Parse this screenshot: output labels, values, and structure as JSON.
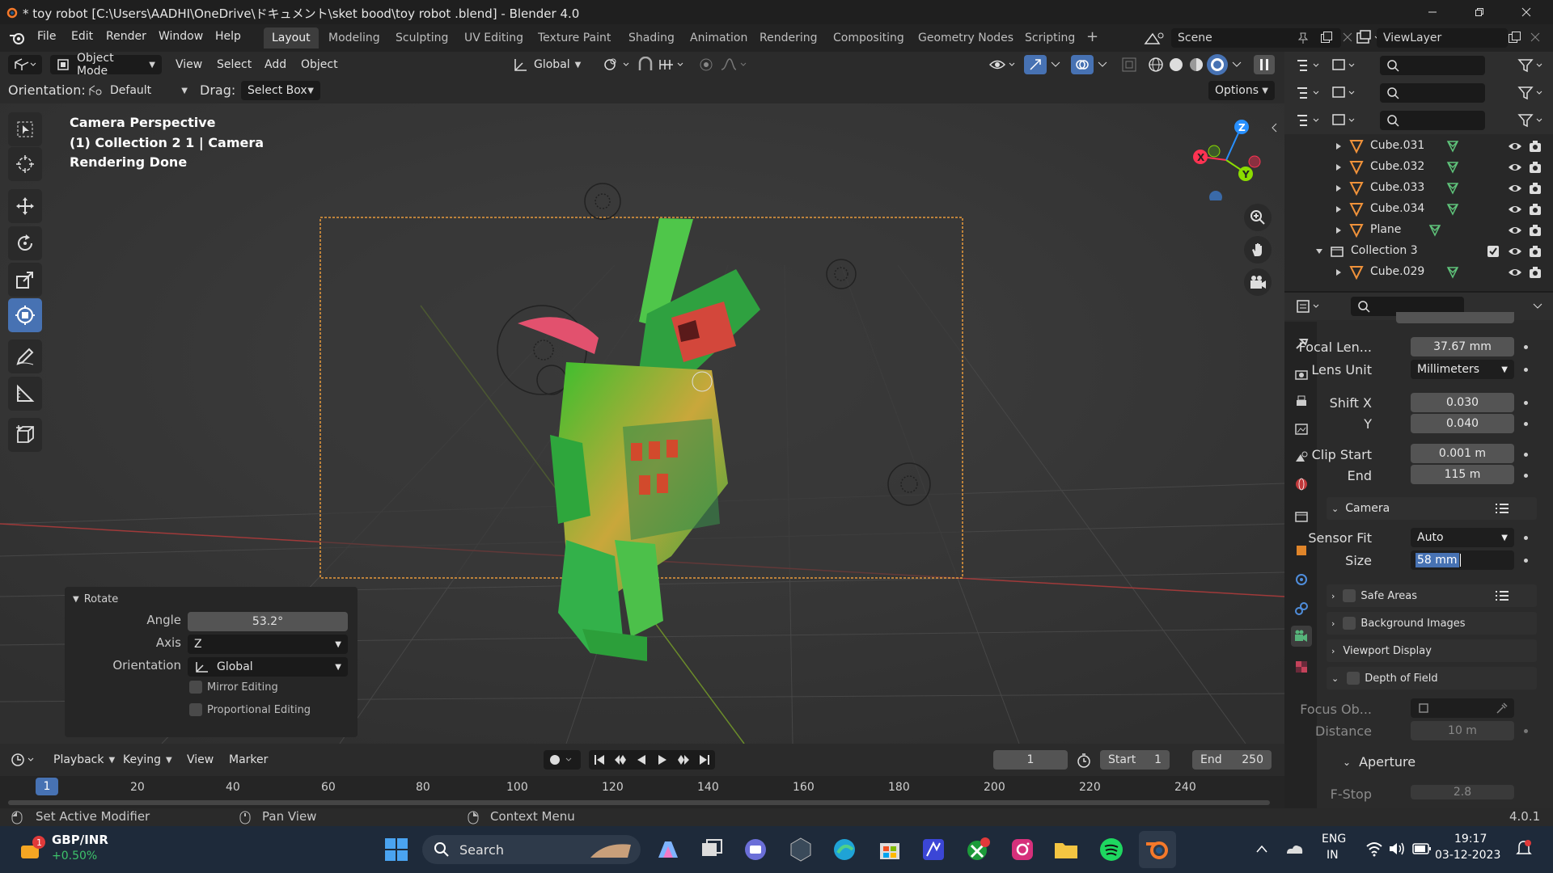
{
  "window": {
    "title": "* toy robot  [C:\\Users\\AADHI\\OneDrive\\ドキュメント\\sket bood\\toy robot .blend] - Blender 4.0"
  },
  "menu": [
    "File",
    "Edit",
    "Render",
    "Window",
    "Help"
  ],
  "workspaces": [
    "Layout",
    "Modeling",
    "Sculpting",
    "UV Editing",
    "Texture Paint",
    "Shading",
    "Animation",
    "Rendering",
    "Compositing",
    "Geometry Nodes",
    "Scripting"
  ],
  "scene": {
    "label": "Scene",
    "view_layer": "ViewLayer"
  },
  "viewport_header": {
    "mode": "Object Mode",
    "menus": [
      "View",
      "Select",
      "Add",
      "Object"
    ],
    "transform_orientation": "Global",
    "orientation_label": "Orientation:",
    "orientation_value": "Default",
    "drag_label": "Drag:",
    "drag_value": "Select Box",
    "options": "Options"
  },
  "viewport_overlay": {
    "line1": "Camera Perspective",
    "line2": "(1) Collection 2 1 | Camera",
    "line3": "Rendering Done"
  },
  "gizmo": {
    "x": "X",
    "y": "Y",
    "z": "Z"
  },
  "operator_panel": {
    "title": "Rotate",
    "angle_label": "Angle",
    "angle_value": "53.2°",
    "axis_label": "Axis",
    "axis_value": "Z",
    "orientation_label": "Orientation",
    "orientation_value": "Global",
    "mirror": "Mirror Editing",
    "proportional": "Proportional Editing"
  },
  "timeline": {
    "menus": [
      "Playback",
      "Keying",
      "View",
      "Marker"
    ],
    "current_frame": "1",
    "start_label": "Start",
    "start_value": "1",
    "end_label": "End",
    "end_value": "250",
    "ticks": [
      "1",
      "20",
      "40",
      "60",
      "80",
      "100",
      "120",
      "140",
      "160",
      "180",
      "200",
      "220",
      "240"
    ]
  },
  "status": {
    "left": "Set Active Modifier",
    "middle": "Pan View",
    "right": "Context Menu",
    "version": "4.0.1"
  },
  "outliner": {
    "rows": [
      {
        "name": "Cube.031",
        "indent": 1,
        "type": "mesh"
      },
      {
        "name": "Cube.032",
        "indent": 1,
        "type": "mesh"
      },
      {
        "name": "Cube.033",
        "indent": 1,
        "type": "mesh"
      },
      {
        "name": "Cube.034",
        "indent": 1,
        "type": "mesh"
      },
      {
        "name": "Plane",
        "indent": 1,
        "type": "mesh"
      },
      {
        "name": "Collection 3",
        "indent": 0,
        "type": "collection"
      },
      {
        "name": "Cube.029",
        "indent": 1,
        "type": "mesh"
      }
    ]
  },
  "properties": {
    "focal_label": "Focal Len...",
    "focal_value": "37.67 mm",
    "lens_unit_label": "Lens Unit",
    "lens_unit_value": "Millimeters",
    "shift_x_label": "Shift X",
    "shift_x_value": "0.030",
    "shift_y_label": "Y",
    "shift_y_value": "0.040",
    "clip_start_label": "Clip Start",
    "clip_start_value": "0.001 m",
    "clip_end_label": "End",
    "clip_end_value": "115 m",
    "camera_section": "Camera",
    "sensor_fit_label": "Sensor Fit",
    "sensor_fit_value": "Auto",
    "size_label": "Size",
    "size_value": "58 mm",
    "safe_areas": "Safe Areas",
    "background_images": "Background Images",
    "viewport_display": "Viewport Display",
    "dof": "Depth of Field",
    "focus_label": "Focus Ob...",
    "distance_label": "Distance",
    "distance_value": "10 m",
    "aperture": "Aperture",
    "fstop_label": "F-Stop",
    "fstop_value": "2.8"
  },
  "taskbar": {
    "ticker_name": "GBP/INR",
    "ticker_change": "+0.50%",
    "search": "Search",
    "lang1": "ENG",
    "lang2": "IN",
    "time": "19:17",
    "date": "03-12-2023"
  },
  "colors": {
    "accent": "#4772b3",
    "camera_frame": "#e89a3c",
    "x_axis": "#ff3352",
    "y_axis": "#8bdc00",
    "z_axis": "#2890ff"
  }
}
